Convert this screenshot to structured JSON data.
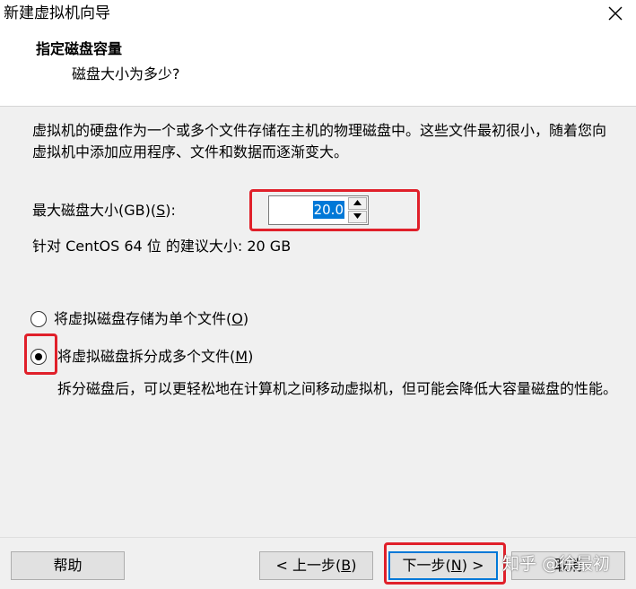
{
  "window": {
    "title": "新建虚拟机向导"
  },
  "header": {
    "title": "指定磁盘容量",
    "subtitle": "磁盘大小为多少?"
  },
  "main": {
    "description": "虚拟机的硬盘作为一个或多个文件存储在主机的物理磁盘中。这些文件最初很小，随着您向虚拟机中添加应用程序、文件和数据而逐渐变大。",
    "size_label_prefix": "最大磁盘大小(GB)(",
    "size_label_key": "S",
    "size_label_suffix": "):",
    "size_value": "20.0",
    "recommend_text": "针对 CentOS 64 位 的建议大小: 20 GB",
    "options": [
      {
        "label_prefix": "将虚拟磁盘存储为单个文件(",
        "key": "O",
        "label_suffix": ")",
        "selected": false
      },
      {
        "label_prefix": "将虚拟磁盘拆分成多个文件(",
        "key": "M",
        "label_suffix": ")",
        "selected": true
      }
    ],
    "split_description": "拆分磁盘后，可以更轻松地在计算机之间移动虚拟机，但可能会降低大容量磁盘的性能。"
  },
  "footer": {
    "help_label": "帮助",
    "back_prefix": "< 上一步(",
    "back_key": "B",
    "back_suffix": ")",
    "next_prefix": "下一步(",
    "next_key": "N",
    "next_suffix": ") >",
    "cancel_label": "取消"
  },
  "watermark": "知乎 @徐最初",
  "colors": {
    "annotation": "#e0202a",
    "selection": "#0078d7",
    "dialog_bg": "#f0f0f0"
  },
  "icons": {
    "close": "close-icon",
    "spin_up": "triangle-up-icon",
    "spin_down": "triangle-down-icon"
  }
}
